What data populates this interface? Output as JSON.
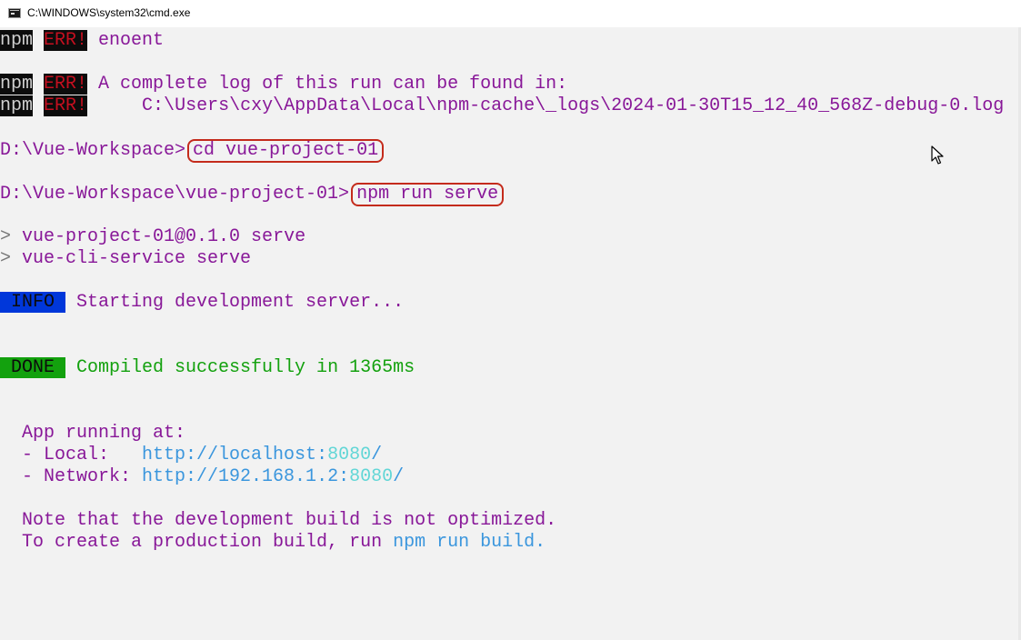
{
  "window": {
    "title": "C:\\WINDOWS\\system32\\cmd.exe"
  },
  "terminal": {
    "line_enoent": {
      "npm": "npm",
      "err": "ERR!",
      "text": " enoent"
    },
    "line_log1": {
      "npm": "npm",
      "err": "ERR!",
      "text": " A complete log of this run can be found in:"
    },
    "line_log2": {
      "npm": "npm",
      "err": "ERR!",
      "text": "     C:\\Users\\cxy\\AppData\\Local\\npm-cache\\_logs\\2024-01-30T15_12_40_568Z-debug-0.log"
    },
    "cmd1": {
      "prompt": "D:\\Vue-Workspace>",
      "command": "cd vue-project-01"
    },
    "cmd2": {
      "prompt": "D:\\Vue-Workspace\\vue-project-01>",
      "command": "npm run serve"
    },
    "script1": {
      "marker": ">",
      "text": " vue-project-01@0.1.0 serve"
    },
    "script2": {
      "marker": ">",
      "text": " vue-cli-service serve"
    },
    "info": {
      "badge": " INFO ",
      "text": " Starting development server..."
    },
    "done": {
      "badge": " DONE ",
      "text": " Compiled successfully in 1365ms"
    },
    "app_running": "  App running at:",
    "local": {
      "label": "  - Local:   ",
      "url": "http://localhost:",
      "port": "8080",
      "slash": "/"
    },
    "network": {
      "label": "  - Network: ",
      "url": "http://192.168.1.2:",
      "port": "8080",
      "slash": "/"
    },
    "note1": "  Note that the development build is not optimized.",
    "note2": {
      "prefix": "  To create a production build, run ",
      "cmd": "npm run build",
      "suffix": "."
    }
  },
  "colors": {
    "console_bg": "#f2f2f2",
    "text_purple": "#881798",
    "error_red": "#c50f1f",
    "info_blue": "#0037da",
    "done_green": "#13a10e",
    "link_blue": "#3a96dd",
    "port_cyan": "#61d6d6",
    "highlight_outline": "#c42b1c"
  },
  "icons": {
    "app": "console-icon",
    "cursor": "mouse-pointer-icon"
  }
}
